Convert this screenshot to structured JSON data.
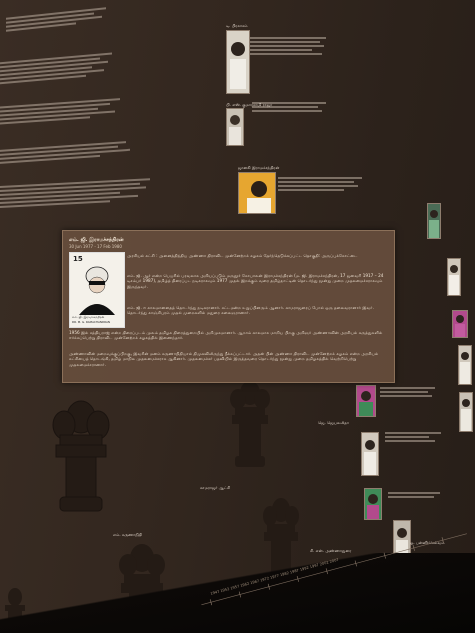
{
  "card": {
    "title": "எம். ஜி. இராமச்சந்திரன்",
    "date_range": "30 Jun 1977 - 17 Feb 1980",
    "stamp": {
      "value": "15",
      "caption": "எம். ஜி. இராமச்சந்திரன்",
      "caption_en": "DR. M. G. RAMACHANDRAN"
    },
    "paragraphs": [
      "அரசியல் கட்சி : அனைத்திந்திய அண்ணா திராவிட முன்னேற்றக் கழகம் தேர்ந்தெடுக்கப்பட்ட தொகுதி: அருப்புக்கோட்டை",
      "எம். ஜி. ஆர் என்ற பெயரில் பரவலாக அறியப்படும் மருதூர் கோபாலன் இராமச்சந்திரன் (ம. ஜி. இராமச்சந்திரன், 17 ஜனவரி 1917 – 24 டிசம்பர் 1987), தமிழ்த் திரைப்பட நடிகராகவும் 1977 முதல் இறக்கும் வரை தமிழ்நாட்டின் தொடர்ந்து மூன்று முறை முதலமைச்சராகவும் இருந்தவர்.",
      "எம். ஜி. ஈ காலமானதைத் தொடர்ந்து நடிகரானார். சட்டமன்ற உறுப்பினரும் ஆனார். காமராஜரைப் போல் ஒரு தலைவரானார் இவர். தொடர்ந்து காஞ்சிபுரம் முதல் முறைகளில் மதுரை கலைஞரானார்.",
      "1956 இல் சத்தியராஜ் என்ற திரைப்படம் முலம் தமிழக திரைத்துறையில் அறிமுகமானார். ஆறாம் காலமாக மாறிய பிறகு அறிஞர் அண்ணாவின் அரசியல் கருத்துகளில் ஈர்க்கப்பெற்று திராவிட முன்னேற்றக் கழகத்தில் இணைந்தார்.",
      "அண்ணாவின் மறைவுக்குப்பிறகு, இவரின் மனம் கருணாநிதியால் திமுகவிலிருந்து நீக்கப்பட்டார். அதன் பின் அண்ணா திராவிட முன்னேற்றக் கழகம் என்ற அரசியல் கட்சியைத் தொடங்கி, தமிழ் மாநில முதலமைச்சராக ஆகினார். முதலமைச்சர் பதவியில் இருந்தவரை தொடர்ந்து மூன்று முறை தமிழகத்தில் வெற்றிபெற்று முதலமைச்சரானார்."
    ]
  },
  "wall_captions": {
    "caption_1": "டி. பிரகாசம்",
    "caption_2": "பி. எஸ். குமாரசாமி ராஜா",
    "caption_3": "ஜானகி இராமச்சந்திரன்",
    "caption_4": "காமராஜர் ஆட்சி",
    "caption_5": "எம். கருணாநிதி",
    "caption_6": "ஜெ. ஜெயலலிதா",
    "caption_7": "சி. என். அண்ணாதுரை",
    "caption_8": "ஓ. பன்னீர்செல்வம்"
  },
  "timeline": {
    "label": "1947 1952 1957 1962 1967 1972 1977 1982 1987 1992 1997 2002 2007"
  },
  "colors": {
    "wall": "#33271f",
    "card": "#664e3c",
    "floor": "#0c0907"
  }
}
